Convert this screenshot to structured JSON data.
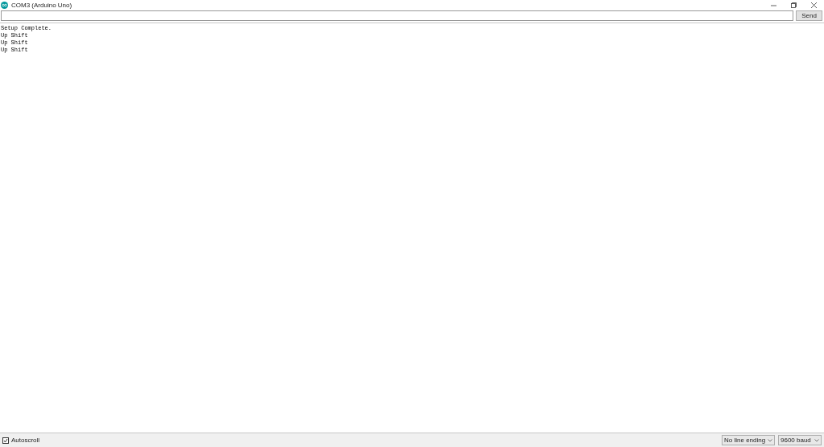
{
  "window": {
    "title": "COM3 (Arduino Uno)"
  },
  "send_button": {
    "label": "Send"
  },
  "output_lines": [
    "Setup Complete.",
    "Up Shift",
    "Up Shift",
    "Up Shift"
  ],
  "autoscroll": {
    "label": "Autoscroll",
    "checked": true
  },
  "line_ending": {
    "value": "No line ending"
  },
  "baud": {
    "value": "9600 baud"
  }
}
